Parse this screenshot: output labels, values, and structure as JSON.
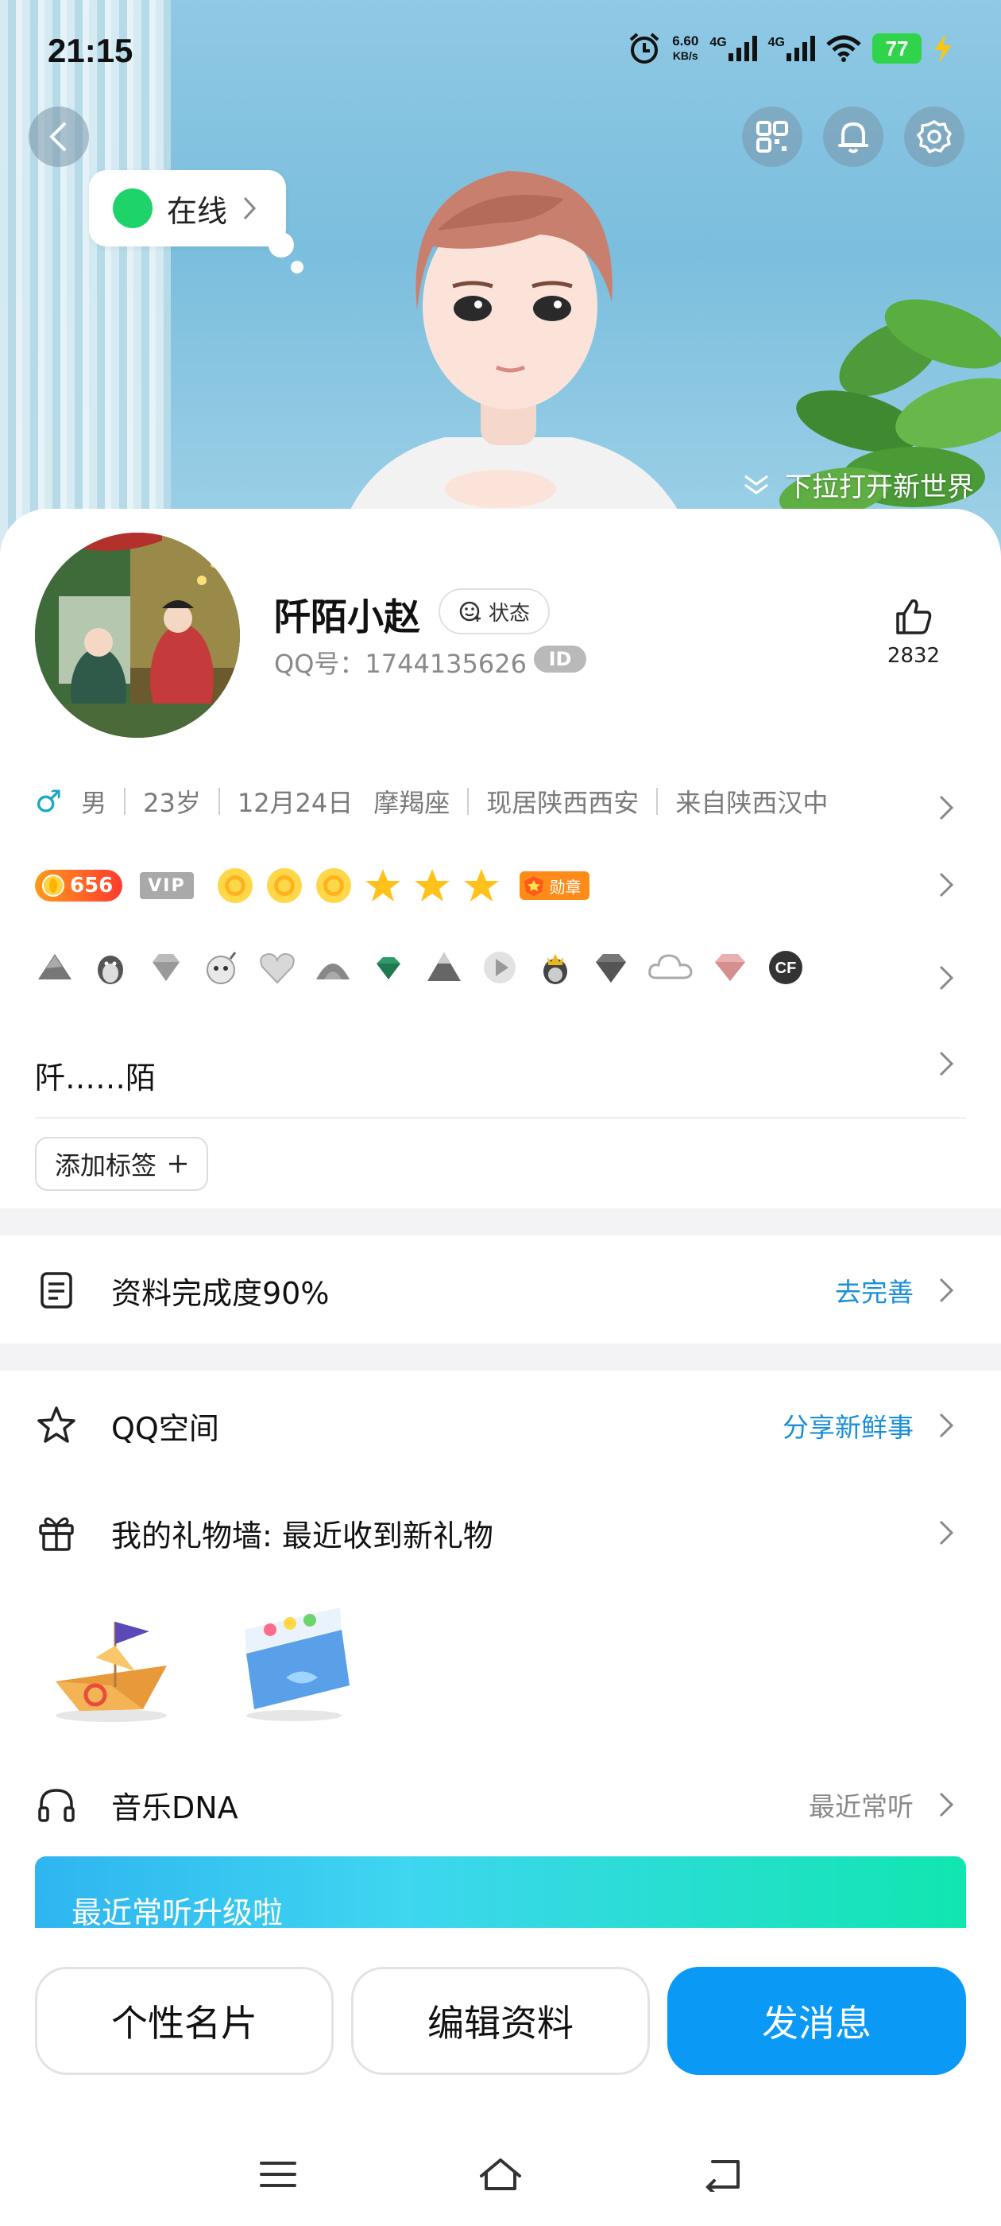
{
  "status_bar": {
    "time": "21:15",
    "net_speed_value": "6.60",
    "net_speed_unit": "KB/s",
    "sim1": "4G",
    "sim2": "4G",
    "battery": "77"
  },
  "hero": {
    "online_status": "在线",
    "pull_hint": "下拉打开新世界"
  },
  "profile": {
    "nickname": "阡陌小赵",
    "status_chip": "状态",
    "qq_number": "QQ号：1744135626",
    "id_badge": "ID",
    "likes": "2832",
    "info": {
      "gender": "男",
      "age": "23岁",
      "birthday": "12月24日",
      "zodiac": "摩羯座",
      "residence": "现居陕西西安",
      "hometown": "来自陕西汉中"
    },
    "level": "656",
    "vip_label": "VIP",
    "medal_label": "勋章",
    "signature": "阡……陌",
    "add_tag": "添加标签"
  },
  "sections": {
    "completeness_label": "资料完成度90%",
    "completeness_action": "去完善",
    "qzone_label": "QQ空间",
    "qzone_action": "分享新鲜事",
    "giftwall_label": "我的礼物墙: 最近收到新礼物",
    "music_label": "音乐DNA",
    "music_action": "最近常听",
    "music_banner": "最近常听升级啦"
  },
  "actions": {
    "card": "个性名片",
    "edit": "编辑资料",
    "message": "发消息"
  },
  "colors": {
    "accent_blue": "#0a99f5",
    "link_blue": "#1a8fd8",
    "online_green": "#1ed36a",
    "battery_green": "#2fd44a"
  }
}
